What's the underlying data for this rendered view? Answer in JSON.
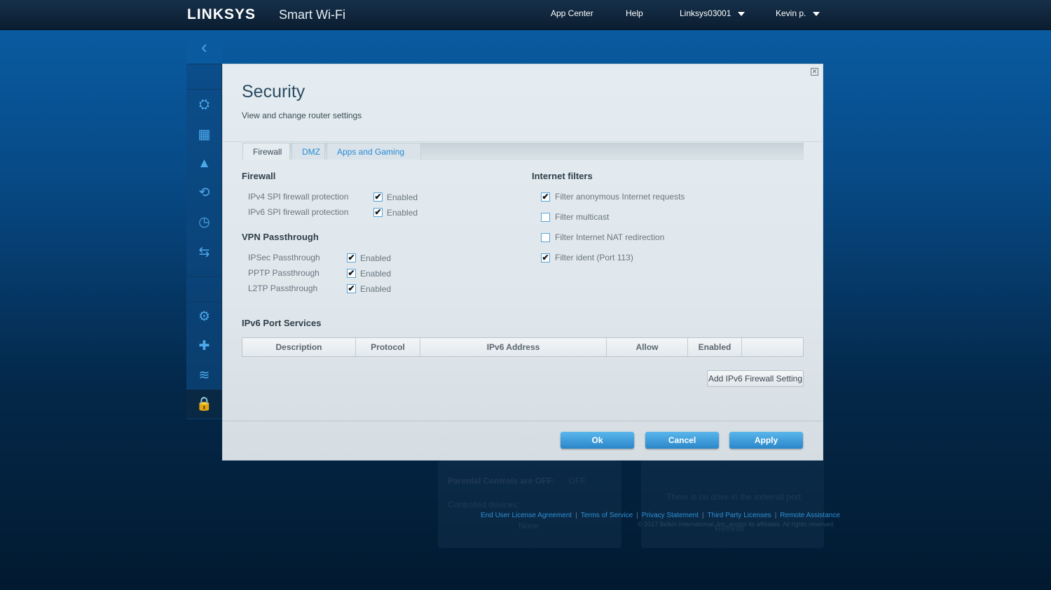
{
  "header": {
    "brand": "LINKSYS",
    "product": "Smart Wi-Fi",
    "nav": [
      "App Center",
      "Help"
    ],
    "router": "Linksys03001",
    "user": "Kevin p."
  },
  "sidebar": {
    "back": "‹",
    "items": [
      {
        "name": "router-icon",
        "glyph": "⛭"
      },
      {
        "name": "device-list-icon",
        "glyph": "▦"
      },
      {
        "name": "parental-controls-icon",
        "glyph": "▲"
      },
      {
        "name": "prioritization-icon",
        "glyph": "⟲"
      },
      {
        "name": "speed-test-icon",
        "glyph": "◷"
      },
      {
        "name": "usb-storage-icon",
        "glyph": "⇆"
      },
      {
        "name": "connectivity-icon",
        "glyph": "⚙"
      },
      {
        "name": "troubleshooting-icon",
        "glyph": "✚"
      },
      {
        "name": "wireless-icon",
        "glyph": "≋"
      },
      {
        "name": "security-icon",
        "glyph": "🔒"
      }
    ]
  },
  "background": {
    "parental": "Parental Controls are OFF:",
    "toggle": "OFF",
    "controlled": "Controlled devices:",
    "none": "None",
    "drive": "There is no drive in the external port.",
    "refresh": "Refresh"
  },
  "modal": {
    "title": "Security",
    "subtitle": "View and change router settings",
    "tabs": [
      "Firewall",
      "DMZ",
      "Apps and Gaming"
    ],
    "firewall": {
      "heading": "Firewall",
      "rows": [
        {
          "label": "IPv4 SPI firewall protection",
          "value": "Enabled",
          "checked": true
        },
        {
          "label": "IPv6 SPI firewall protection",
          "value": "Enabled",
          "checked": true
        }
      ]
    },
    "vpn": {
      "heading": "VPN Passthrough",
      "rows": [
        {
          "label": "IPSec Passthrough",
          "value": "Enabled",
          "checked": true
        },
        {
          "label": "PPTP Passthrough",
          "value": "Enabled",
          "checked": true
        },
        {
          "label": "L2TP Passthrough",
          "value": "Enabled",
          "checked": true
        }
      ]
    },
    "filters": {
      "heading": "Internet filters",
      "rows": [
        {
          "label": "Filter anonymous Internet requests",
          "checked": true
        },
        {
          "label": "Filter multicast",
          "checked": false
        },
        {
          "label": "Filter Internet NAT redirection",
          "checked": false
        },
        {
          "label": "Filter ident (Port 113)",
          "checked": true
        }
      ]
    },
    "ipv6": {
      "heading": "IPv6 Port Services",
      "columns": [
        "Description",
        "Protocol",
        "IPv6 Address",
        "Allow",
        "Enabled",
        ""
      ],
      "add": "Add IPv6 Firewall Setting"
    },
    "buttons": {
      "ok": "Ok",
      "cancel": "Cancel",
      "apply": "Apply"
    },
    "check": "✔",
    "close": "✕"
  },
  "footer": {
    "links": [
      "End User License Agreement",
      "Terms of Service",
      "Privacy Statement",
      "Third Party Licenses",
      "Remote Assistance"
    ],
    "copyright": "© 2017 Belkin International, Inc. and/or its affiliates. All rights reserved."
  },
  "colors": {
    "accent": "#2a8bd6",
    "header": "#0f2236"
  }
}
